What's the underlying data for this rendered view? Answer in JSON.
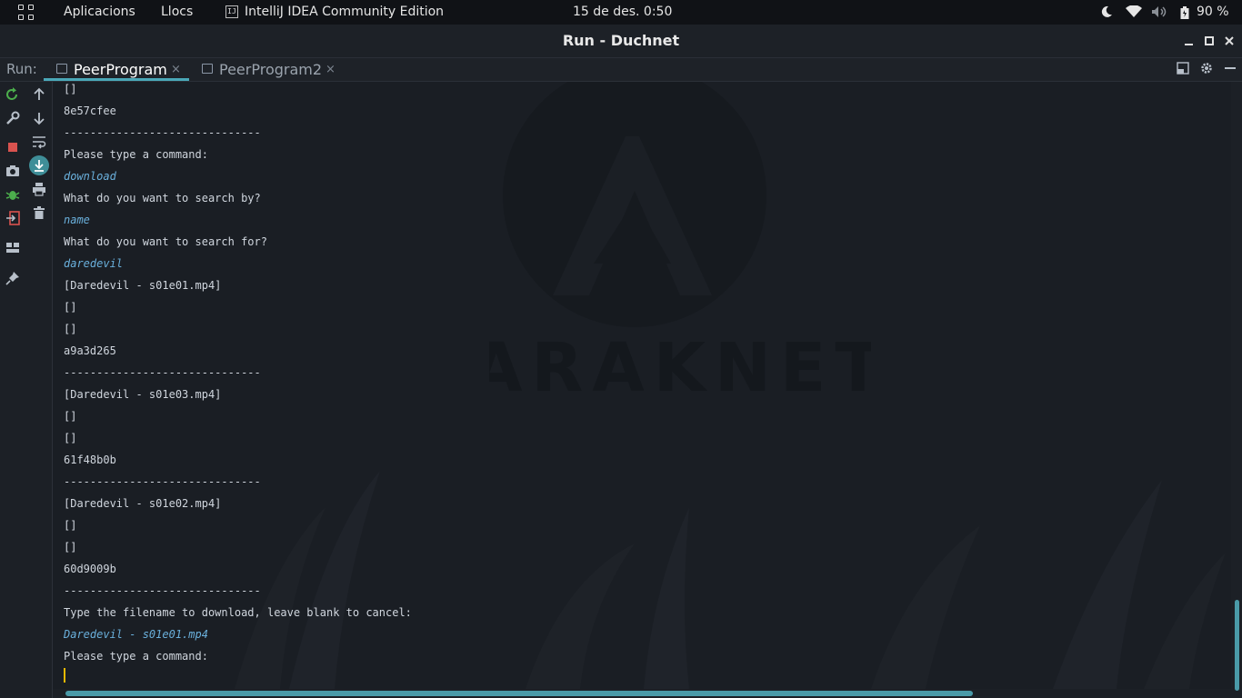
{
  "topbar": {
    "apps_label": "Aplicacions",
    "places_label": "Llocs",
    "active_app": "IntelliJ IDEA Community Edition",
    "active_app_icon": "IJ",
    "clock": "15 de des.  0:50",
    "battery": "90 %",
    "tray_icons": [
      "night-light-icon",
      "wifi-icon",
      "volume-icon",
      "battery-icon"
    ]
  },
  "window": {
    "title": "Run - Duchnet",
    "buttons": [
      "minimize-icon",
      "maximize-icon",
      "close-icon"
    ]
  },
  "run_bar": {
    "label": "Run:",
    "tabs": [
      {
        "label": "PeerProgram",
        "active": true
      },
      {
        "label": "PeerProgram2",
        "active": false
      }
    ],
    "close_glyph": "×",
    "right_icons": [
      "layout-icon",
      "settings-gear-icon",
      "hide-icon"
    ]
  },
  "left_toolbar": [
    "rerun-icon",
    "wrench-icon",
    "stop-icon",
    "camera-icon",
    "debug-bug-icon",
    "exit-icon",
    "layout-icon",
    "pin-icon"
  ],
  "console_toolbar": [
    "up-arrow-icon",
    "down-arrow-icon",
    "soft-wrap-icon",
    "scroll-to-end-icon",
    "print-icon",
    "trash-icon"
  ],
  "console": {
    "lines": [
      {
        "text": "[]",
        "kind": "output"
      },
      {
        "text": "8e57cfee",
        "kind": "output"
      },
      {
        "text": "------------------------------",
        "kind": "output"
      },
      {
        "text": "Please type a command:",
        "kind": "output"
      },
      {
        "text": "download",
        "kind": "input"
      },
      {
        "text": "What do you want to search by?",
        "kind": "output"
      },
      {
        "text": "name",
        "kind": "input"
      },
      {
        "text": "What do you want to search for?",
        "kind": "output"
      },
      {
        "text": "daredevil",
        "kind": "input"
      },
      {
        "text": "[Daredevil - s01e01.mp4]",
        "kind": "output"
      },
      {
        "text": "[]",
        "kind": "output"
      },
      {
        "text": "[]",
        "kind": "output"
      },
      {
        "text": "a9a3d265",
        "kind": "output"
      },
      {
        "text": "------------------------------",
        "kind": "output"
      },
      {
        "text": "[Daredevil - s01e03.mp4]",
        "kind": "output"
      },
      {
        "text": "[]",
        "kind": "output"
      },
      {
        "text": "[]",
        "kind": "output"
      },
      {
        "text": "61f48b0b",
        "kind": "output"
      },
      {
        "text": "------------------------------",
        "kind": "output"
      },
      {
        "text": "[Daredevil - s01e02.mp4]",
        "kind": "output"
      },
      {
        "text": "[]",
        "kind": "output"
      },
      {
        "text": "[]",
        "kind": "output"
      },
      {
        "text": "60d9009b",
        "kind": "output"
      },
      {
        "text": "------------------------------",
        "kind": "output"
      },
      {
        "text": "Type the filename to download, leave blank to cancel:",
        "kind": "output"
      },
      {
        "text": "Daredevil - s01e01.mp4",
        "kind": "input"
      },
      {
        "text": "Please type a command:",
        "kind": "output"
      }
    ],
    "watermark_text": "ARAKNET"
  },
  "colors": {
    "accent": "#4aa8b8",
    "input_text": "#6ab0dc",
    "caret": "#e6b800",
    "background": "#1a1e24"
  }
}
